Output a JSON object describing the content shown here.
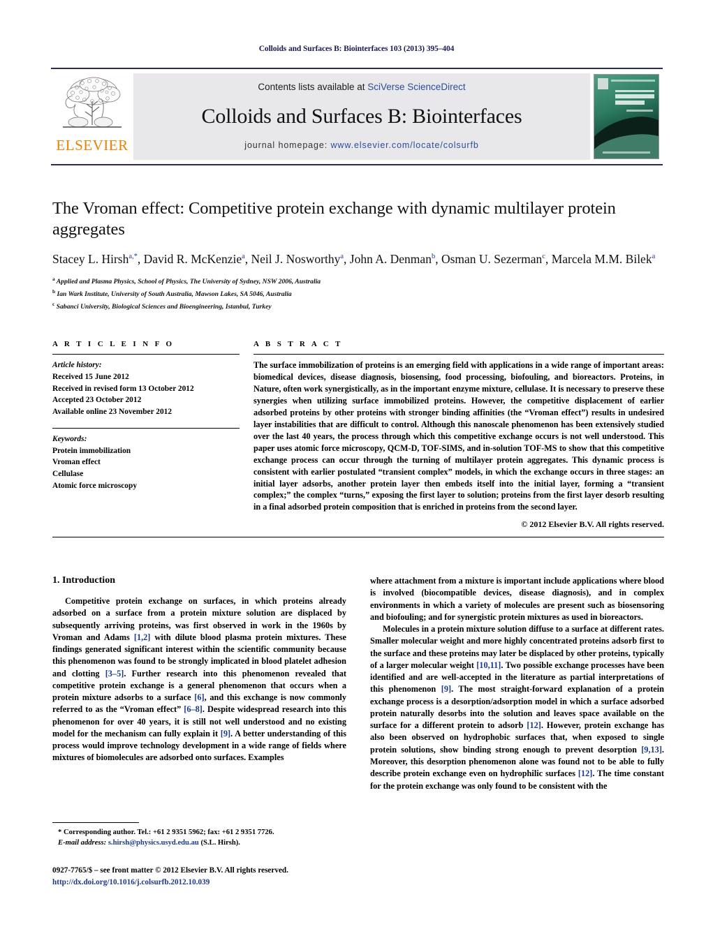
{
  "running_head": "Colloids and Surfaces B: Biointerfaces 103 (2013) 395–404",
  "masthead": {
    "publisher_name": "ELSEVIER",
    "contents_prefix": "Contents lists available at ",
    "contents_link": "SciVerse ScienceDirect",
    "journal_title": "Colloids and Surfaces B: Biointerfaces",
    "homepage_prefix": "journal homepage: ",
    "homepage_url": "www.elsevier.com/locate/colsurfb",
    "cover_title_line1": "COLLOIDS AND",
    "cover_title_line2": "SURFACES B"
  },
  "title": "The Vroman effect: Competitive protein exchange with dynamic multilayer protein aggregates",
  "authors": [
    {
      "name": "Stacey L. Hirsh",
      "marks": "a,*"
    },
    {
      "name": "David R. McKenzie",
      "marks": "a"
    },
    {
      "name": "Neil J. Nosworthy",
      "marks": "a"
    },
    {
      "name": "John A. Denman",
      "marks": "b"
    },
    {
      "name": "Osman U. Sezerman",
      "marks": "c"
    },
    {
      "name": "Marcela M.M. Bilek",
      "marks": "a"
    }
  ],
  "affiliations": [
    {
      "mark": "a",
      "text": "Applied and Plasma Physics, School of Physics, The University of Sydney, NSW 2006, Australia"
    },
    {
      "mark": "b",
      "text": "Ian Wark Institute, University of South Australia, Mawson Lakes, SA 5046, Australia"
    },
    {
      "mark": "c",
      "text": "Sabanci University, Biological Sciences and Bioengineering, Istanbul, Turkey"
    }
  ],
  "article_info": {
    "heading": "A R T I C L E   I N F O",
    "history_label": "Article history:",
    "history": [
      "Received 15 June 2012",
      "Received in revised form 13 October 2012",
      "Accepted 23 October 2012",
      "Available online 23 November 2012"
    ],
    "keywords_label": "Keywords:",
    "keywords": [
      "Protein immobilization",
      "Vroman effect",
      "Cellulase",
      "Atomic force microscopy"
    ]
  },
  "abstract": {
    "heading": "A B S T R A C T",
    "text": "The surface immobilization of proteins is an emerging field with applications in a wide range of important areas: biomedical devices, disease diagnosis, biosensing, food processing, biofouling, and bioreactors. Proteins, in Nature, often work synergistically, as in the important enzyme mixture, cellulase. It is necessary to preserve these synergies when utilizing surface immobilized proteins. However, the competitive displacement of earlier adsorbed proteins by other proteins with stronger binding affinities (the “Vroman effect”) results in undesired layer instabilities that are difficult to control. Although this nanoscale phenomenon has been extensively studied over the last 40 years, the process through which this competitive exchange occurs is not well understood. This paper uses atomic force microscopy, QCM-D, TOF-SIMS, and in-solution TOF-MS to show that this competitive exchange process can occur through the turning of multilayer protein aggregates. This dynamic process is consistent with earlier postulated “transient complex” models, in which the exchange occurs in three stages: an initial layer adsorbs, another protein layer then embeds itself into the initial layer, forming a “transient complex;” the complex “turns,” exposing the first layer to solution; proteins from the first layer desorb resulting in a final adsorbed protein composition that is enriched in proteins from the second layer.",
    "copyright": "© 2012 Elsevier B.V. All rights reserved."
  },
  "body": {
    "section_number_title": "1.  Introduction",
    "left_paragraph": "Competitive protein exchange on surfaces, in which proteins already adsorbed on a surface from a protein mixture solution are displaced by subsequently arriving proteins, was first observed in work in the 1960s by Vroman and Adams [1,2] with dilute blood plasma protein mixtures. These findings generated significant interest within the scientific community because this phenomenon was found to be strongly implicated in blood platelet adhesion and clotting [3–5]. Further research into this phenomenon revealed that competitive protein exchange is a general phenomenon that occurs when a protein mixture adsorbs to a surface [6], and this exchange is now commonly referred to as the “Vroman effect” [6–8]. Despite widespread research into this phenomenon for over 40 years, it is still not well understood and no existing model for the mechanism can fully explain it [9]. A better understanding of this process would improve technology development in a wide range of fields where mixtures of biomolecules are adsorbed onto surfaces. Examples",
    "right_paragraph_1": "where attachment from a mixture is important include applications where blood is involved (biocompatible devices, disease diagnosis), and in complex environments in which a variety of molecules are present such as biosensoring and biofouling; and for synergistic protein mixtures as used in bioreactors.",
    "right_paragraph_2": "Molecules in a protein mixture solution diffuse to a surface at different rates. Smaller molecular weight and more highly concentrated proteins adsorb first to the surface and these proteins may later be displaced by other proteins, typically of a larger molecular weight [10,11]. Two possible exchange processes have been identified and are well-accepted in the literature as partial interpretations of this phenomenon [9]. The most straight-forward explanation of a protein exchange process is a desorption/adsorption model in which a surface adsorbed protein naturally desorbs into the solution and leaves space available on the surface for a different protein to adsorb [12]. However, protein exchange has also been observed on hydrophobic surfaces that, when exposed to single protein solutions, show binding strong enough to prevent desorption [9,13]. Moreover, this desorption phenomenon alone was found not to be able to fully describe protein exchange even on hydrophilic surfaces [12]. The time constant for the protein exchange was only found to be consistent with the"
  },
  "footnote": {
    "corresponding": "* Corresponding author. Tel.: +61 2 9351 5962; fax: +61 2 9351 7726.",
    "email_label": "E-mail address:",
    "email": "s.hirsh@physics.usyd.edu.au",
    "email_suffix": "(S.L. Hirsh)."
  },
  "issn_line": "0927-7765/$ – see front matter © 2012 Elsevier B.V. All rights reserved.",
  "doi_line": "http://dx.doi.org/10.1016/j.colsurfb.2012.10.039",
  "colors": {
    "header_navy": "#1a1a4e",
    "link_blue": "#2b4c9b",
    "ref_blue": "#1a3a8a",
    "elsevier_orange": "#f08000",
    "masthead_gray": "#e8e8ea"
  }
}
